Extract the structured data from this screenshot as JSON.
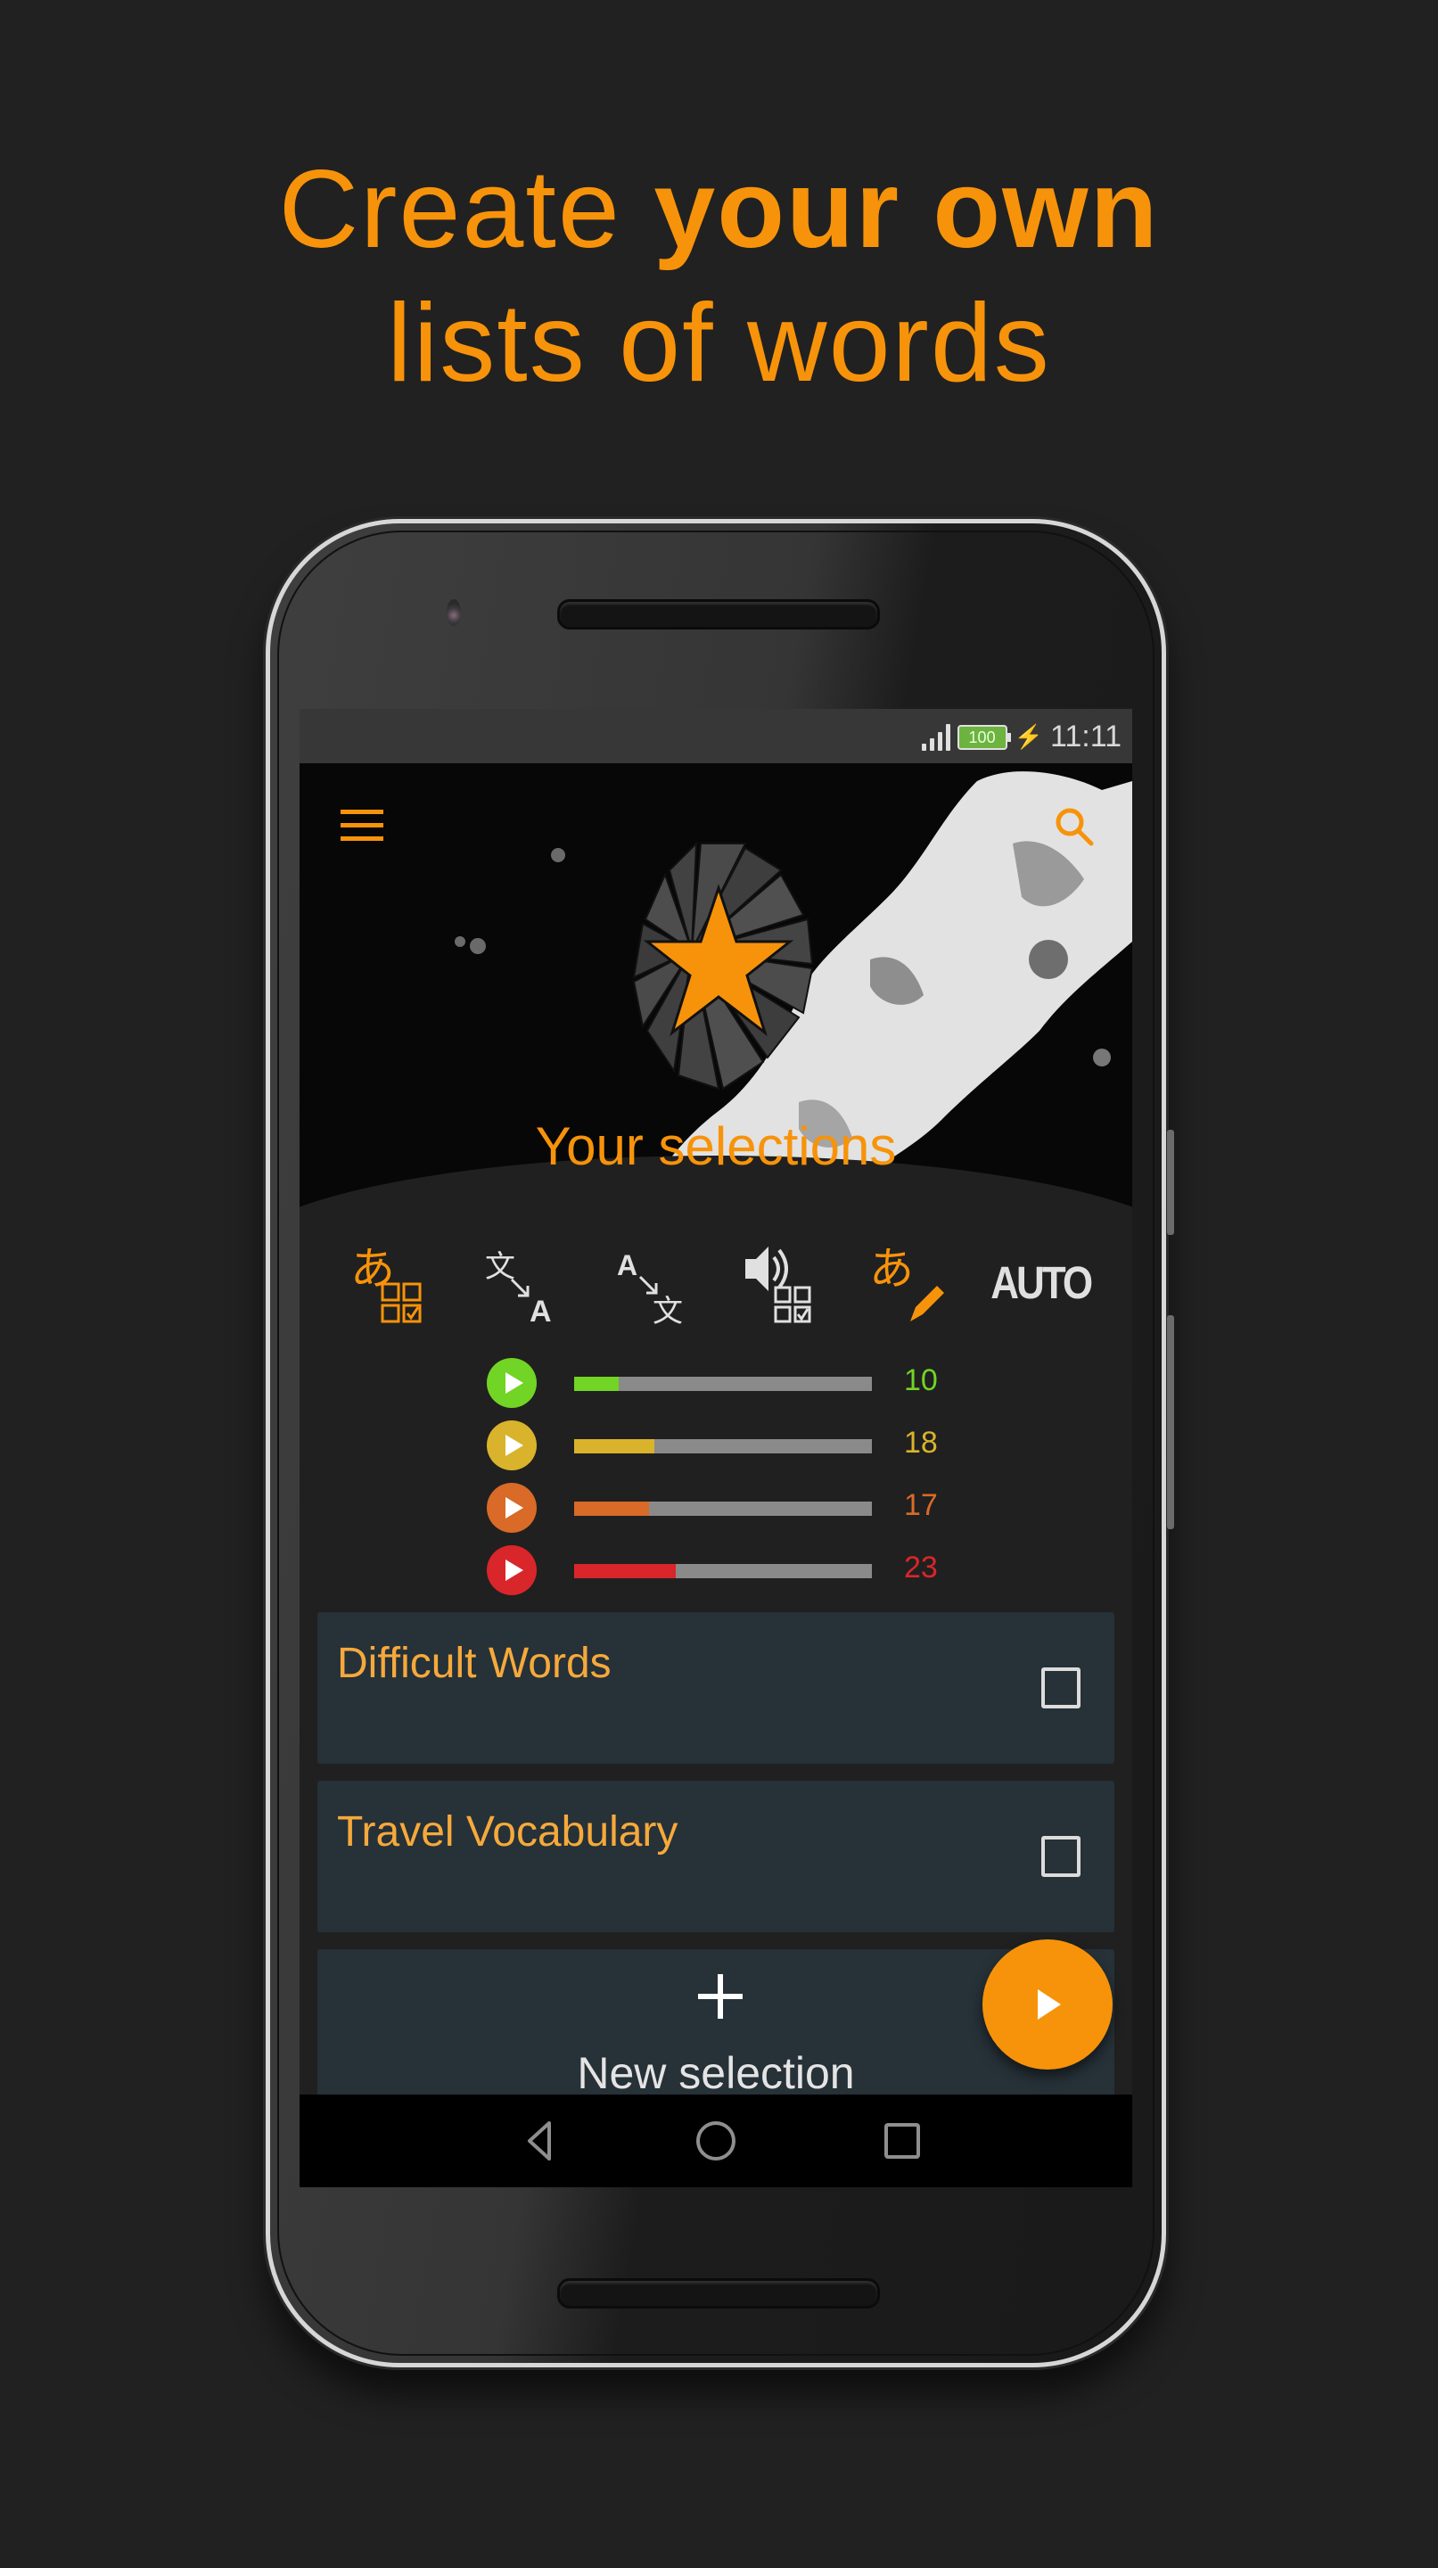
{
  "headline": {
    "line1_light": "Create",
    "line1_bold": "your own",
    "line2": "lists of words"
  },
  "status_bar": {
    "battery_level": "100",
    "time": "11:11",
    "charging": true
  },
  "header": {
    "title": "Your selections",
    "menu_icon": "hamburger-menu-icon",
    "search_icon": "search-icon",
    "emblem_icon": "star-emblem-icon"
  },
  "modes": [
    {
      "name": "kana-to-choice",
      "icon": "kana-multiple-choice-icon",
      "active": true
    },
    {
      "name": "kanji-to-latin",
      "icon": "translate-to-latin-icon",
      "active": false
    },
    {
      "name": "latin-to-kanji",
      "icon": "translate-to-kanji-icon",
      "active": false
    },
    {
      "name": "audio-to-choice",
      "icon": "audio-multiple-choice-icon",
      "active": false
    },
    {
      "name": "kana-writing",
      "icon": "kana-write-icon",
      "active": true
    },
    {
      "name": "auto",
      "label": "AUTO",
      "active": false
    }
  ],
  "levels": [
    {
      "count": "10",
      "progress": 0.15,
      "color": "#72d425"
    },
    {
      "count": "18",
      "progress": 0.27,
      "color": "#d9b32b"
    },
    {
      "count": "17",
      "progress": 0.25,
      "color": "#d96a27"
    },
    {
      "count": "23",
      "progress": 0.34,
      "color": "#d9262a"
    }
  ],
  "selections": [
    {
      "name": "Difficult Words",
      "checked": false
    },
    {
      "name": "Travel Vocabulary",
      "checked": false
    }
  ],
  "new_selection": {
    "label": "New selection"
  },
  "fab": {
    "icon": "play-icon"
  },
  "colors": {
    "accent": "#f7930a",
    "card_bg": "#263138",
    "list_name": "#f6a93b",
    "screen_bg": "#202020"
  },
  "nav": {
    "back_icon": "back-icon",
    "home_icon": "home-icon",
    "recents_icon": "recents-icon"
  }
}
